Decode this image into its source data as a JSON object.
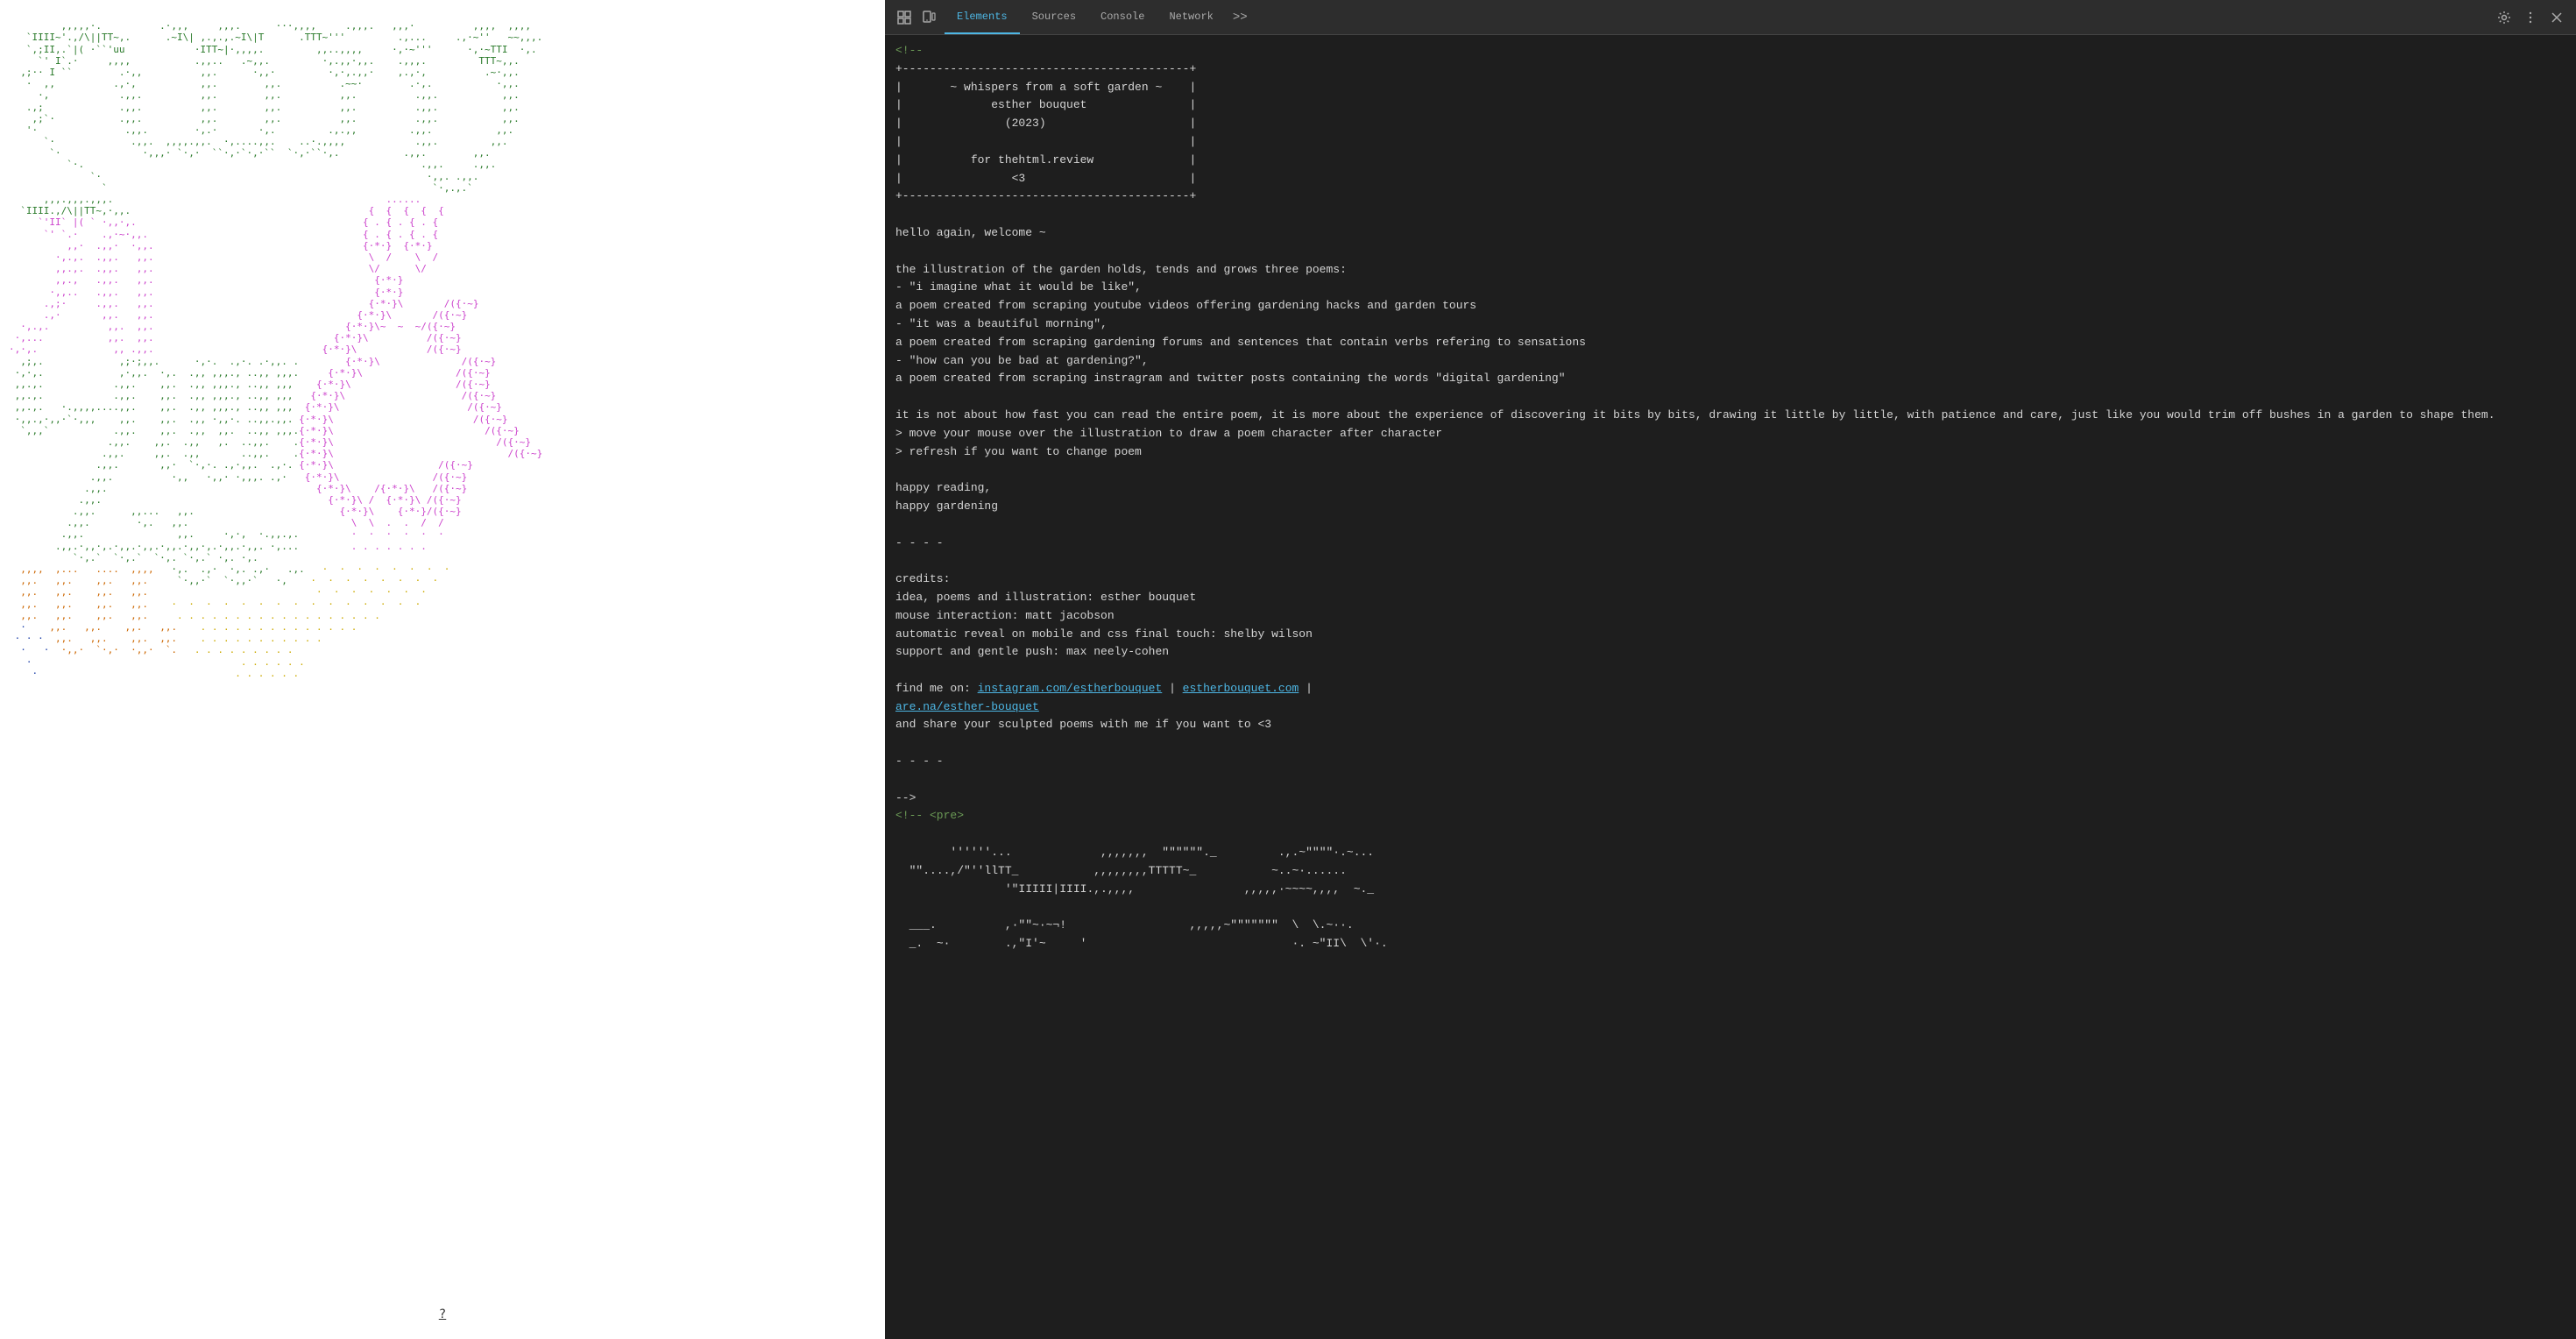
{
  "left": {
    "page_number": "?"
  },
  "devtools": {
    "tabs": [
      {
        "label": "⬡",
        "id": "logo",
        "active": false
      },
      {
        "label": "⬜",
        "id": "inspector-icon",
        "active": false
      },
      {
        "label": "Elements",
        "id": "elements",
        "active": true
      },
      {
        "label": "Sources",
        "id": "sources",
        "active": false
      },
      {
        "label": "Console",
        "id": "console",
        "active": false
      },
      {
        "label": "Network",
        "id": "network",
        "active": false
      }
    ],
    "content": {
      "box_top": "<!--",
      "box_border": "+------------------------------------------+",
      "box_row1": "|       ~ whispers from a soft garden ~    |",
      "box_row2": "|             esther bouquet               |",
      "box_row3": "|               (2023)                     |",
      "box_row4": "|                                          |",
      "box_row5": "|          for thehtml.review              |",
      "box_row6": "|                <3                        |",
      "box_bottom": "+------------------------------------------+",
      "para1": "hello again, welcome ~",
      "para2_line1": "the illustration of the garden holds, tends and grows three poems:",
      "para2_line2": "- \"i imagine what it would be like\",",
      "para2_line3": "a poem created from scraping youtube videos offering gardening hacks and garden tours",
      "para2_line4": "- \"it was a beautiful morning\",",
      "para2_line5": "a poem created from scraping gardening forums and sentences that contain verbs refering to sensations",
      "para2_line6": "- \"how can you be bad at gardening?\",",
      "para2_line7": "a poem created from scraping instragram and twitter posts containing the words \"digital gardening\"",
      "para3_line1": "it is not about how fast you can read the entire poem, it is more about the experience of discovering it bits by bits, drawing it little by little, with patience and care, just like you would trim off bushes in a garden to shape them.",
      "para3_line2": "> move your mouse over the illustration to draw a poem character after character",
      "para3_line3": "> refresh if you want to change poem",
      "para4_line1": "happy reading,",
      "para4_line2": "happy gardening",
      "separator": "- - - -",
      "credits_title": "credits:",
      "credit1": "idea, poems and illustration: esther bouquet",
      "credit2": "mouse interaction: matt jacobson",
      "credit3": "automatic reveal on mobile and css final touch: shelby wilson",
      "credit4": "support and gentle push: max neely-cohen",
      "find_line1": "find me on: instagram.com/estherbouquet | estherbouquet.com |",
      "find_line2": "are.na/esther-bouquet",
      "share": "and share your sculpted poems with me if you want to <3",
      "separator2": "- - - -",
      "arrow": "-->",
      "pre_tag": "<!-- <pre>",
      "ascii_sample_lines": [
        "        ''''''...             ,,,,,,,  \"\"\"\"\"\"._         .,.~\"\"\"\"\"·.~...",
        "  \"\"\"...,/\"''llTT_           ,,,,,,,,TTTTT~_           ~..~·......",
        "                '\"\"IIIII|IIII.,.,,,,                ,,,,,·~~~~,,,,  ~._",
        "                                                                        ",
        "  ___.          ,·\"\"\"~·~¬!                  ,,,,,~\"\"\"\"\"\"\"\"\"\"  \\  \\.~··.",
        "  _.  ~·        .,\"\"\"I'~     '                              ·. ~\"II\\  \\'·.",
        "         '\"\" I  '                                                         "
      ]
    }
  }
}
